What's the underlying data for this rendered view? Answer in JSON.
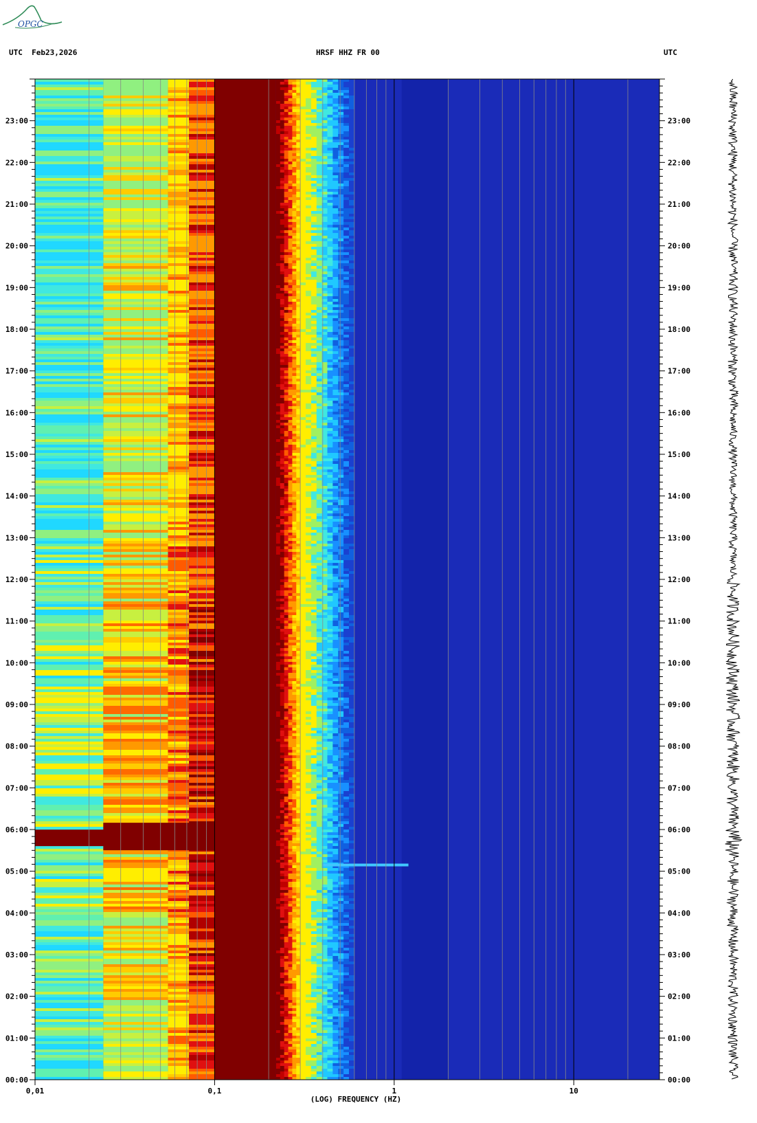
{
  "header": {
    "left": "UTC  Feb23,2026",
    "center": "HRSF HHZ FR 00",
    "right": "UTC"
  },
  "logo": {
    "text": "OPGC",
    "color": "#2e8b57",
    "text_color": "#1e50a0"
  },
  "colors": {
    "background_blue": "#1a2bb8",
    "dark_blue": "#0c1a9a",
    "dark_red": "#800000",
    "red": "#e01010",
    "orange": "#ff8c00",
    "yellow": "#ffee00",
    "cyan": "#20d8ff"
  },
  "chart_data": {
    "type": "heatmap",
    "title": "HRSF HHZ FR 00",
    "date": "Feb23,2026",
    "xlabel": "(LOG) FREQUENCY (HZ)",
    "x_scale": "log",
    "xlim": [
      0.01,
      30
    ],
    "x_ticks": [
      {
        "value": 0.01,
        "label": "0,01"
      },
      {
        "value": 0.1,
        "label": "0,1"
      },
      {
        "value": 1,
        "label": "1"
      },
      {
        "value": 10,
        "label": "10"
      }
    ],
    "ylabel": "UTC",
    "ylim_hours": [
      0,
      24
    ],
    "y_ticks": [
      "00:00",
      "01:00",
      "02:00",
      "03:00",
      "04:00",
      "05:00",
      "06:00",
      "07:00",
      "08:00",
      "09:00",
      "10:00",
      "11:00",
      "12:00",
      "13:00",
      "14:00",
      "15:00",
      "16:00",
      "17:00",
      "18:00",
      "19:00",
      "20:00",
      "21:00",
      "22:00",
      "23:00"
    ],
    "grid": true,
    "bands": [
      {
        "f_min": 0.01,
        "f_max": 0.024,
        "palette": "cyan-green-yellow"
      },
      {
        "f_min": 0.024,
        "f_max": 0.055,
        "palette": "green-yellow-orange"
      },
      {
        "f_min": 0.055,
        "f_max": 0.072,
        "palette": "yellow-orange-red"
      },
      {
        "f_min": 0.072,
        "f_max": 0.1,
        "palette": "orange-red-darkred"
      },
      {
        "f_min": 0.1,
        "f_max": 0.22,
        "palette": "darkred"
      },
      {
        "f_min": 0.22,
        "f_max": 0.3,
        "palette": "red-orange-yellow"
      },
      {
        "f_min": 0.3,
        "f_max": 0.6,
        "palette": "cyan-blue"
      },
      {
        "f_min": 0.6,
        "f_max": 30,
        "palette": "blue"
      }
    ],
    "events": [
      {
        "hour": 5.8,
        "f_min": 0.01,
        "f_max": 0.1,
        "level": "high"
      },
      {
        "hour": 5.15,
        "f_min": 0.4,
        "f_max": 1.2,
        "level": "medium"
      }
    ]
  }
}
